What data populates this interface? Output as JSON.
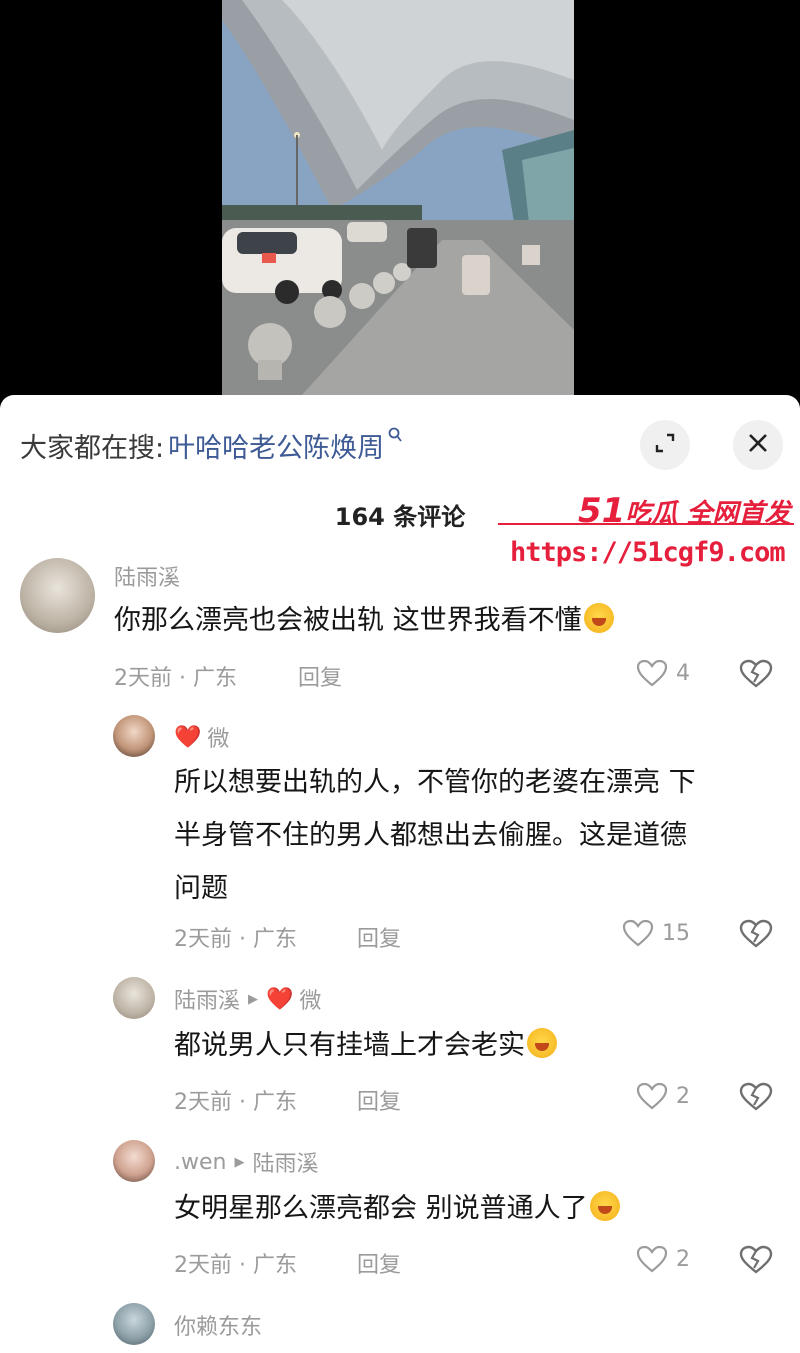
{
  "search": {
    "prefix": "大家都在搜:",
    "query": "叶哈哈老公陈焕周",
    "icon": "search-icon"
  },
  "header": {
    "comment_count": "164 条评论",
    "expand_icon": "expand-icon",
    "close_icon": "close-icon"
  },
  "watermark": {
    "brand_num": "51",
    "brand_text": "吃瓜 全网首发",
    "url": "https://51cgf9.com"
  },
  "comments": [
    {
      "author": "陆雨溪",
      "text": "你那么漂亮也会被出轨 这世界我看不懂",
      "emoji": "crying-laughing-emoji",
      "time_location": "2天前 · 广东",
      "reply_label": "回复",
      "likes": "4"
    },
    {
      "author": "微",
      "author_heart": "❤️",
      "text_lines": [
        "所以想要出轨的人，不管你的老婆在漂亮 下",
        "半身管不住的男人都想出去偷腥。这是道德",
        "问题"
      ],
      "time_location": "2天前 · 广东",
      "reply_label": "回复",
      "likes": "15"
    },
    {
      "author": "陆雨溪",
      "reply_to": "微",
      "reply_to_heart": "❤️",
      "text": "都说男人只有挂墙上才会老实",
      "emoji": "crying-laughing-emoji",
      "time_location": "2天前 · 广东",
      "reply_label": "回复",
      "likes": "2"
    },
    {
      "author": ".wen",
      "reply_to": "陆雨溪",
      "text": "女明星那么漂亮都会 别说普通人了",
      "emoji": "tearful-smile-emoji",
      "time_location": "2天前 · 广东",
      "reply_label": "回复",
      "likes": "2"
    },
    {
      "author": "你赖东东"
    }
  ],
  "colors": {
    "link": "#3e5b96",
    "meta_gray": "#9b9b9b",
    "watermark_red": "#e6203c",
    "heart_red": "#e02a2a"
  }
}
